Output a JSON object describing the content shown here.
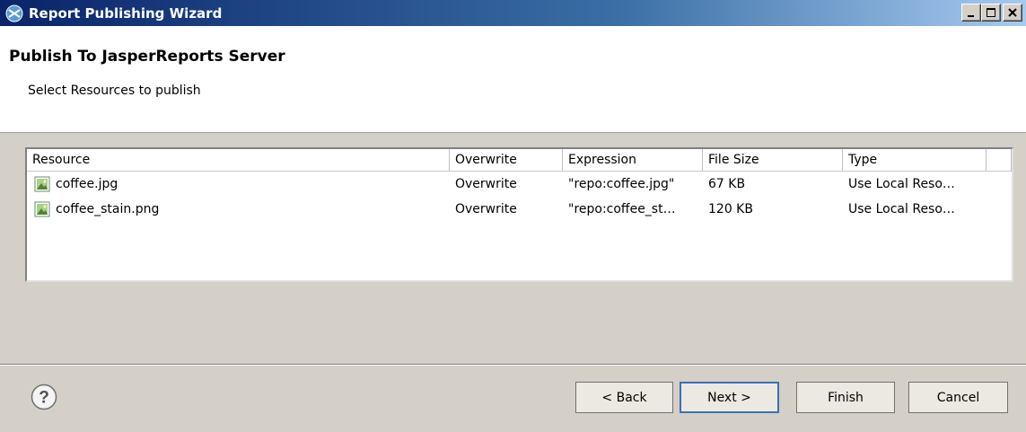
{
  "window": {
    "title": "Report Publishing Wizard",
    "app_icon": "jasper-icon",
    "controls": [
      "minimize-icon",
      "maximize-icon",
      "close-icon"
    ]
  },
  "header": {
    "title": "Publish To JasperReports Server",
    "subtitle": "Select Resources to publish"
  },
  "table": {
    "columns": [
      "Resource",
      "Overwrite",
      "Expression",
      "File Size",
      "Type"
    ],
    "rows": [
      {
        "icon": "image-file-icon",
        "resource": "coffee.jpg",
        "overwrite": "Overwrite",
        "expression": "\"repo:coffee.jpg\"",
        "file_size": "67 KB",
        "type": "Use Local Reso…"
      },
      {
        "icon": "image-file-icon",
        "resource": "coffee_stain.png",
        "overwrite": "Overwrite",
        "expression": "\"repo:coffee_st…",
        "file_size": "120 KB",
        "type": "Use Local Reso…"
      }
    ]
  },
  "footer": {
    "help_icon": "help-icon",
    "back_label": "< Back",
    "next_label": "Next >",
    "finish_label": "Finish",
    "cancel_label": "Cancel"
  },
  "colors": {
    "titlebar_start": "#0a246a",
    "titlebar_end": "#a6caf0",
    "dialog_bg": "#d4d0c8",
    "default_button_border": "#3c6fb4"
  }
}
